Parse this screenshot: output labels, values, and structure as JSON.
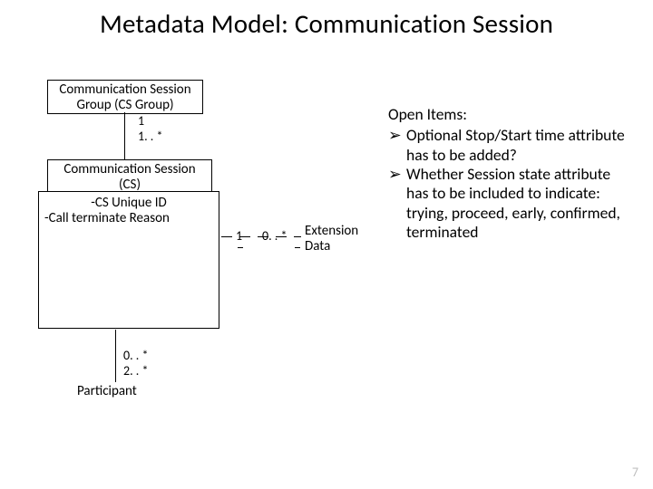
{
  "title": "Metadata Model: Communication Session",
  "group_box": {
    "line1": "Communication Session",
    "line2": "Group (CS Group)"
  },
  "mult_group_bottom": "1",
  "mult_cs_top": "1. . *",
  "cs_head": {
    "line1": "Communication Session",
    "line2": "(CS)"
  },
  "cs_attrs": {
    "a1": "-CS Unique ID",
    "a2": "-Call terminate Reason"
  },
  "mult_ext_left": "1",
  "mult_ext_right": "0. . *",
  "ext_label": {
    "line1": "Extension",
    "line2": "Data"
  },
  "mult_part_top": "0. . *",
  "mult_part_bottom": "2. . *",
  "participant_label": "Participant",
  "open_items": {
    "header": "Open Items:",
    "bullet": "➢",
    "i1": "Optional Stop/Start time attribute has to be added?",
    "i2": "Whether Session state attribute has to be included to indicate: trying, proceed, early, confirmed, terminated"
  },
  "page_number": "7",
  "chart_data": {
    "type": "table",
    "description": "UML-like class diagram for Communication Session metadata",
    "entities": [
      {
        "name": "Communication Session Group (CS Group)",
        "attributes": []
      },
      {
        "name": "Communication Session (CS)",
        "attributes": [
          "CS Unique ID",
          "Call terminate Reason"
        ]
      },
      {
        "name": "Extension Data",
        "attributes": []
      },
      {
        "name": "Participant",
        "attributes": []
      }
    ],
    "relationships": [
      {
        "from": "Communication Session Group (CS Group)",
        "from_mult": "1",
        "to": "Communication Session (CS)",
        "to_mult": "1..*"
      },
      {
        "from": "Communication Session (CS)",
        "from_mult": "1",
        "to": "Extension Data",
        "to_mult": "0..*"
      },
      {
        "from": "Communication Session (CS)",
        "from_mult": "0..*",
        "to": "Participant",
        "to_mult": "2..*"
      }
    ],
    "open_items": [
      "Optional Stop/Start time attribute has to be added?",
      "Whether Session state attribute has to be included to indicate: trying, proceed, early, confirmed, terminated"
    ]
  }
}
